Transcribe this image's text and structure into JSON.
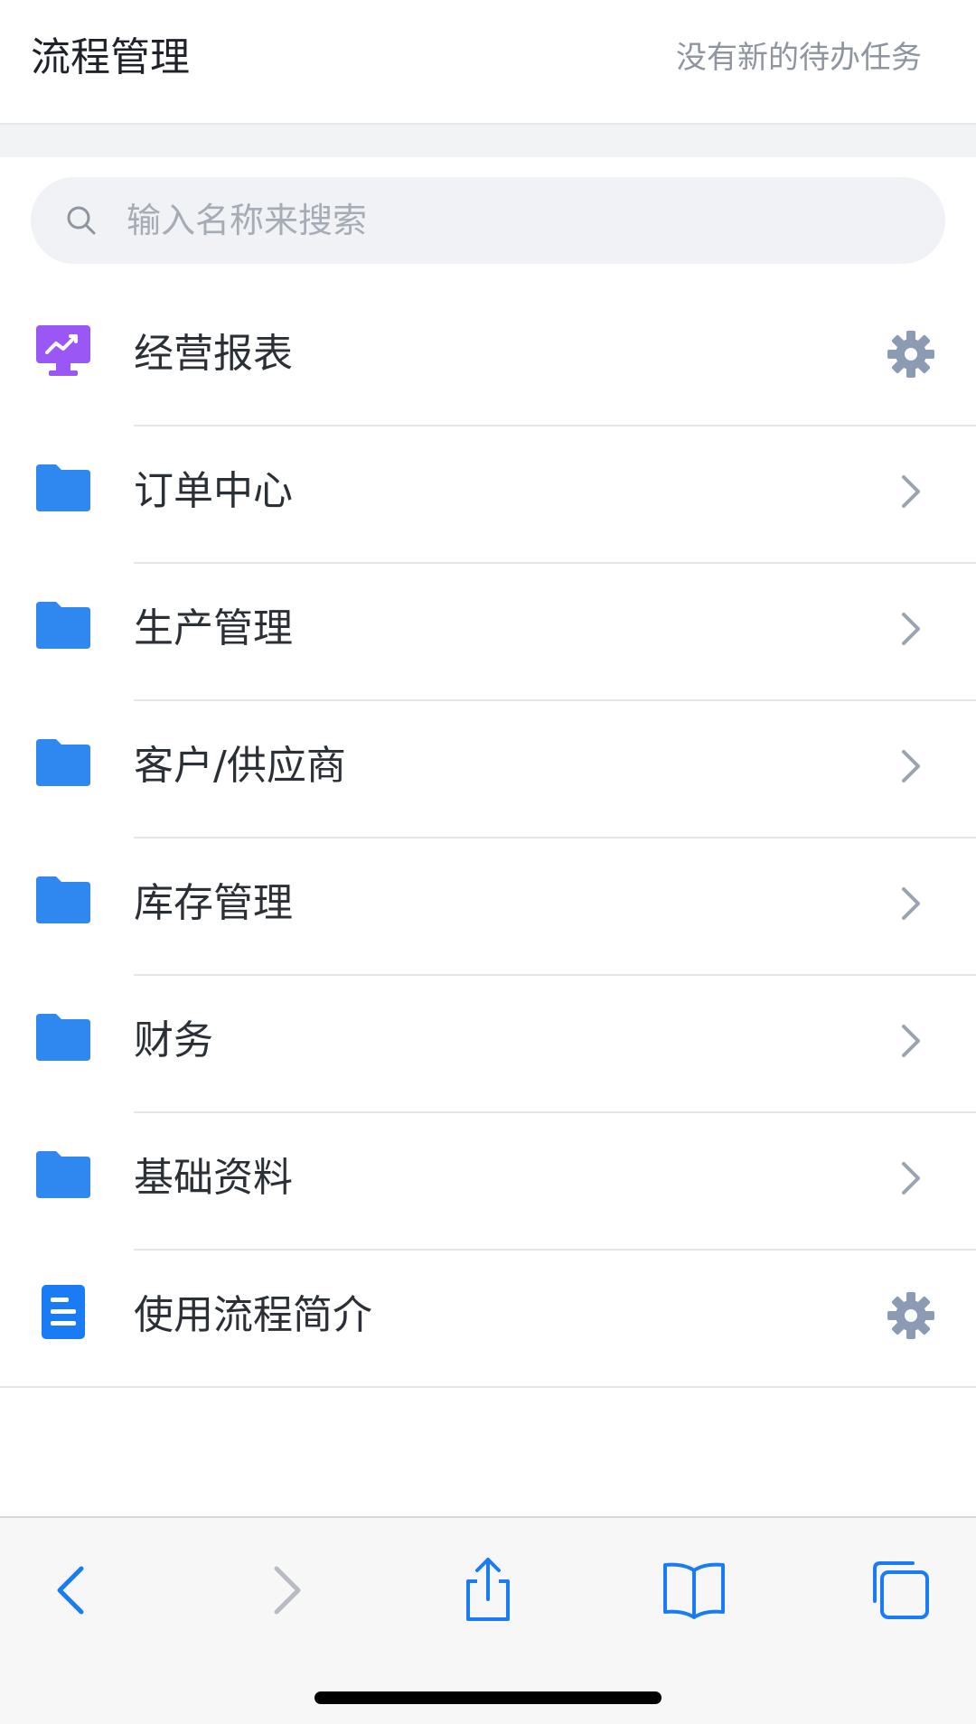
{
  "header": {
    "title": "流程管理",
    "status": "没有新的待办任务"
  },
  "search": {
    "placeholder": "输入名称来搜索",
    "icon": "search-icon"
  },
  "list": {
    "items": [
      {
        "label": "经营报表",
        "icon": "monitor-chart-icon",
        "action": "gear-icon"
      },
      {
        "label": "订单中心",
        "icon": "folder-icon",
        "action": "chevron-right-icon"
      },
      {
        "label": "生产管理",
        "icon": "folder-icon",
        "action": "chevron-right-icon"
      },
      {
        "label": "客户/供应商",
        "icon": "folder-icon",
        "action": "chevron-right-icon"
      },
      {
        "label": "库存管理",
        "icon": "folder-icon",
        "action": "chevron-right-icon"
      },
      {
        "label": "财务",
        "icon": "folder-icon",
        "action": "chevron-right-icon"
      },
      {
        "label": "基础资料",
        "icon": "folder-icon",
        "action": "chevron-right-icon"
      },
      {
        "label": "使用流程简介",
        "icon": "document-icon",
        "action": "gear-icon"
      }
    ]
  },
  "toolbar": {
    "items": [
      {
        "name": "back",
        "icon": "chevron-left-icon",
        "enabled": true
      },
      {
        "name": "forward",
        "icon": "chevron-right-icon",
        "enabled": false
      },
      {
        "name": "share",
        "icon": "share-icon",
        "enabled": true
      },
      {
        "name": "bookmarks",
        "icon": "book-icon",
        "enabled": true
      },
      {
        "name": "tabs",
        "icon": "tabs-icon",
        "enabled": true
      }
    ]
  },
  "colors": {
    "accent": "#1a7cf5",
    "folder": "#2f88f0",
    "report": "#9a57f5",
    "gear": "#8a9bb3",
    "chevron": "#9aa4b2",
    "text_secondary": "#8f959e"
  }
}
